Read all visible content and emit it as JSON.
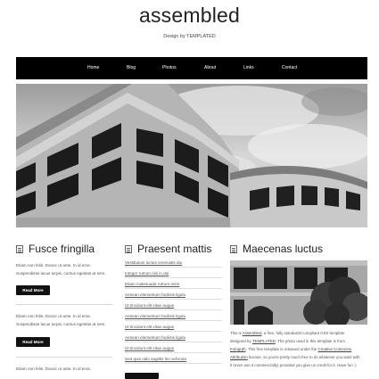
{
  "header": {
    "title": "assembled",
    "tagline": "Design by TEMPLATED"
  },
  "nav": {
    "items": [
      {
        "label": "Home"
      },
      {
        "label": "Blog"
      },
      {
        "label": "Photos"
      },
      {
        "label": "About"
      },
      {
        "label": "Links"
      },
      {
        "label": "Contact"
      }
    ]
  },
  "columns": {
    "left": {
      "title": "Fusce fringilla",
      "posts": [
        {
          "line1": "Etiam non felis. Donec ut ante. In id eros.",
          "line2": "Suspendisse lacus turpis, cursus egestas at sem.",
          "button": "Read More"
        },
        {
          "line1": "Etiam non felis. Donec ut ante. In id eros.",
          "line2": "Suspendisse lacus turpis, cursus egestas at sem.",
          "button": "Read More"
        },
        {
          "line1": "Etiam non felis. Donec ut ante. In id eros.",
          "line2": "",
          "button": ""
        }
      ]
    },
    "middle": {
      "title": "Praesent mattis",
      "links": [
        "Vestibulum luctus venenatis dui",
        "Integer rutrum nisi in dui",
        "Etiam malesuada rutrum enim",
        "Aenean elementum facilisis ligula",
        "Ut tincidunt elit vitae augue",
        "Aenean elementum facilisis ligula",
        "Ut tincidunt elit vitae augue",
        "Aenean elementum facilisis ligula",
        "Ut tincidunt elit vitae augue",
        "Sed quis odio sagittis leo vehicula"
      ]
    },
    "right": {
      "title": "Maecenas luctus",
      "text": {
        "l1a": "This is ",
        "l1b": "Assembled",
        "l1c": ", a free, fully standards-compliant CSS template",
        "l2a": "designed by ",
        "l2b": "TEMPLATED",
        "l2c": ". The photo used in this template is from",
        "l3a": "Fotogrph",
        "l3b": ". This free template is released under the ",
        "l3c": "Creative Commons",
        "l4a": "Attribution",
        "l4b": " license, so you're pretty much free to do whatever you want with",
        "l5": "it (even use it commercially) provided you give us credit for it. Have fun :)"
      }
    }
  }
}
